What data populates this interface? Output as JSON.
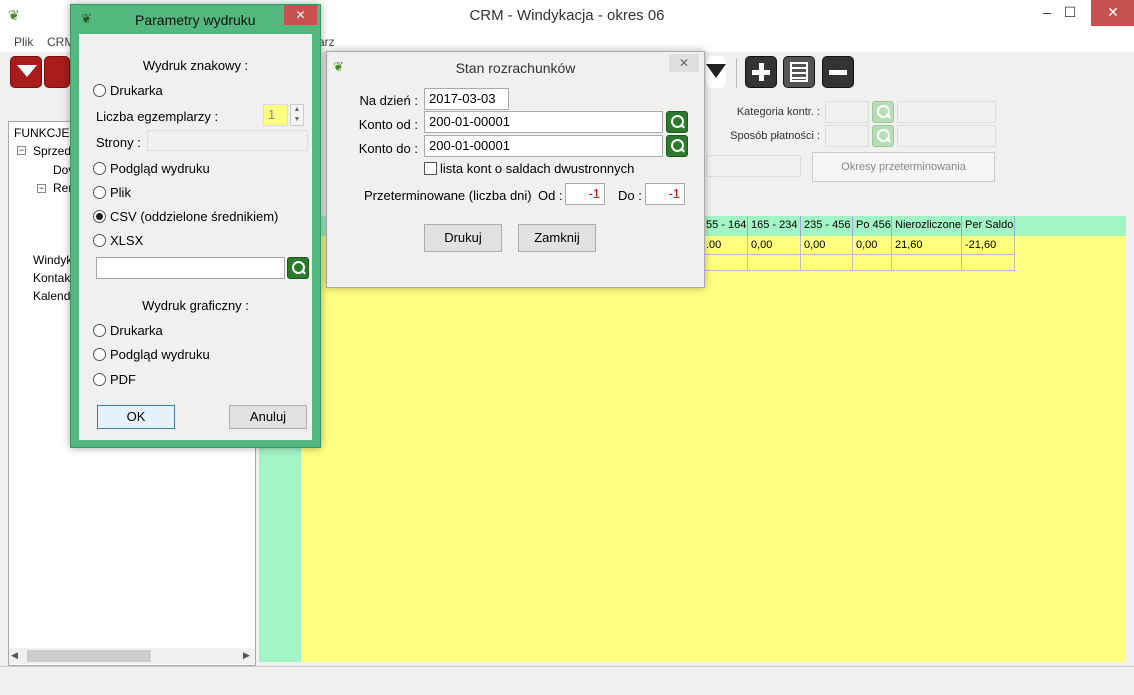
{
  "app": {
    "title": "CRM - Windykacja - okres 06",
    "window_controls": {
      "minimize": "–",
      "maximize": "☐",
      "close": "✕"
    }
  },
  "menu": {
    "items": [
      "Plik",
      "CRM",
      "arz"
    ]
  },
  "tree": {
    "items": [
      "FUNKCJE C",
      "Sprzeda",
      "Dov",
      "Rer",
      "Windyk",
      "Kontak",
      "Kalend"
    ]
  },
  "filters": {
    "kategoria_label": "Kategoria kontr. :",
    "sposob_label": "Sposób płatności :",
    "okresy_button": "Okresy przeterminowania"
  },
  "grid": {
    "headers": [
      "55 - 164",
      "165 - 234",
      "235 - 456",
      "Po 456",
      "Nierozliczone",
      "Per Saldo"
    ],
    "row1": [
      ".00",
      "0,00",
      "0,00",
      "0,00",
      "21,60",
      "-21,60"
    ]
  },
  "print_dialog": {
    "title": "Parametry wydruku",
    "close": "✕",
    "section_text": "Wydruk znakowy :",
    "opt_printer": "Drukarka",
    "copies_label": "Liczba egzemplarzy :",
    "copies_value": "1",
    "pages_label": "Strony :",
    "opt_preview": "Podgląd wydruku",
    "opt_file": "Plik",
    "opt_csv": "CSV (oddzielone średnikiem)",
    "opt_xlsx": "XLSX",
    "section_graphic": "Wydruk graficzny :",
    "g_opt_printer": "Drukarka",
    "g_opt_preview": "Podgląd wydruku",
    "g_opt_pdf": "PDF",
    "ok": "OK",
    "cancel": "Anuluj",
    "selected_option": "CSV (oddzielone średnikiem)"
  },
  "balance_dialog": {
    "title": "Stan rozrachunków",
    "close": "✕",
    "date_label": "Na dzień :",
    "date_value": "2017-03-03",
    "account_from_label": "Konto od :",
    "account_from_value": "200-01-00001",
    "account_to_label": "Konto do :",
    "account_to_value": "200-01-00001",
    "checkbox_label": "lista kont o saldach dwustronnych",
    "overdue_label": "Przeterminowane (liczba dni)",
    "od_label": "Od :",
    "od_value": "-1",
    "do_label": "Do :",
    "do_value": "-1",
    "print_button": "Drukuj",
    "close_button": "Zamknij"
  },
  "colors": {
    "grid_yellow": "#ffff80",
    "grid_green": "#a2f5c5",
    "dialog_green": "#53b87e",
    "toolbar_red": "#a81c1c",
    "negative_red": "#e00000"
  }
}
